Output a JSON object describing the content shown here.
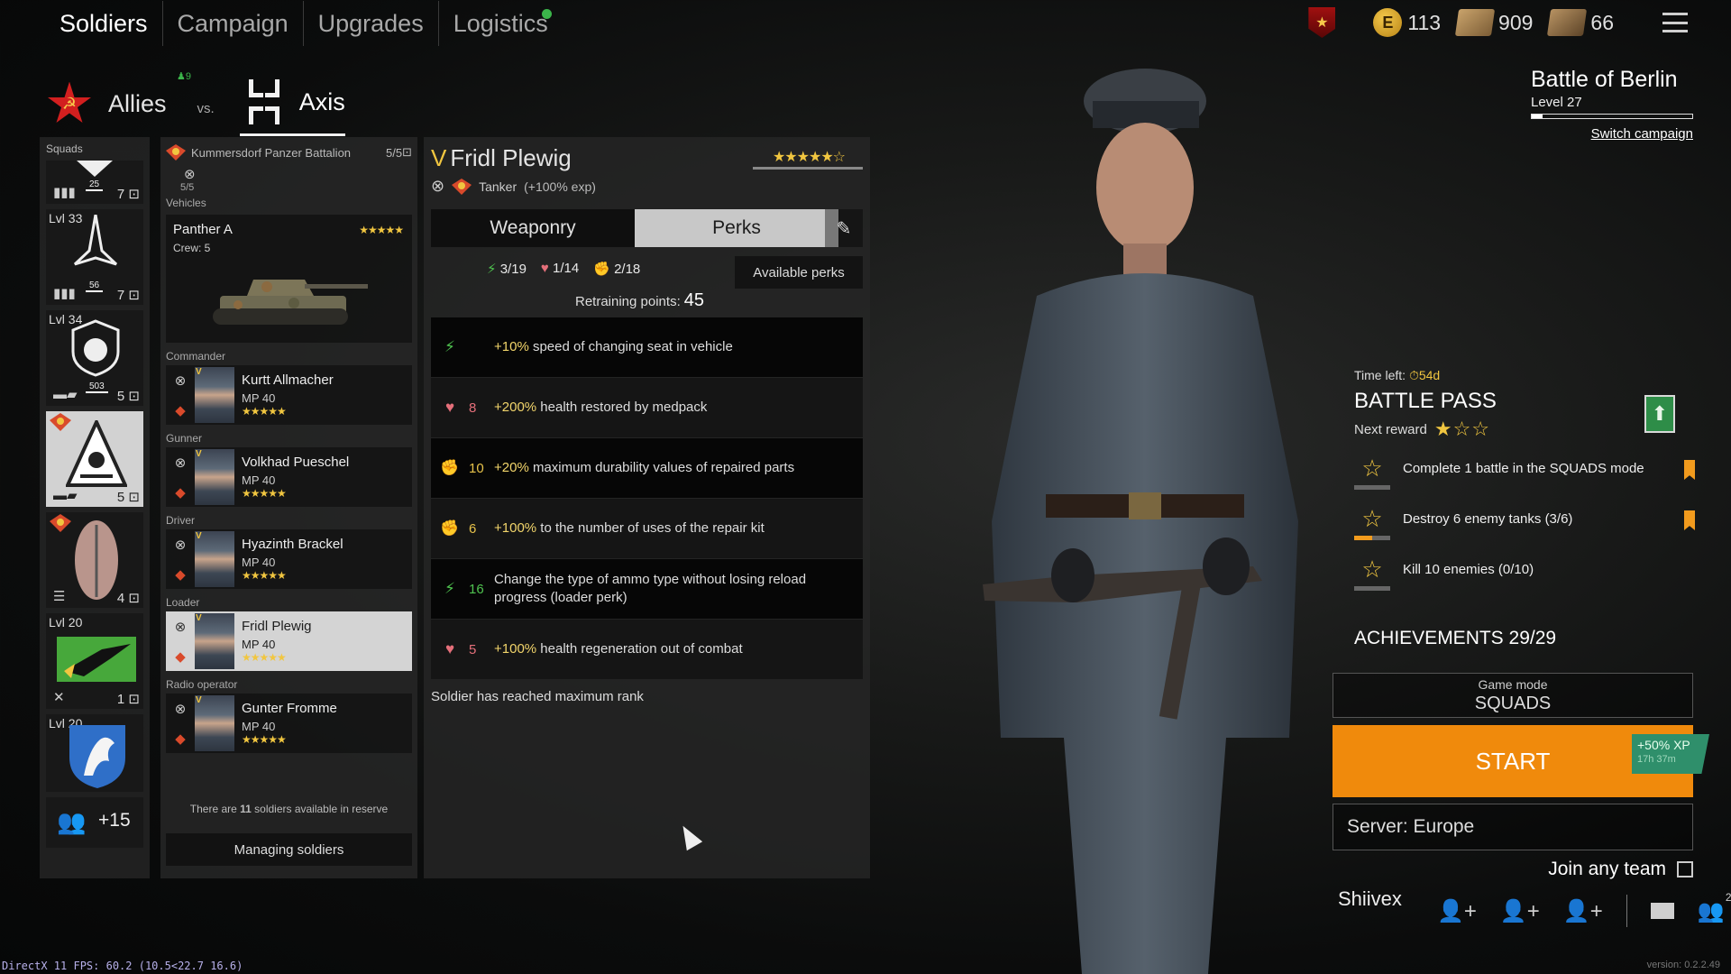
{
  "nav": {
    "tabs": [
      {
        "label": "Soldiers",
        "active": true
      },
      {
        "label": "Campaign"
      },
      {
        "label": "Upgrades"
      },
      {
        "label": "Logistics"
      }
    ]
  },
  "currencies": {
    "gold": "113",
    "tickets": "909",
    "orders": "66"
  },
  "faction": {
    "allies_label": "Allies",
    "allies_count": "♟9",
    "vs": "vs.",
    "axis_label": "Axis"
  },
  "squads": {
    "header": "Squads",
    "items": [
      {
        "level": "",
        "num": "25",
        "count": "7"
      },
      {
        "level": "Lvl 33",
        "num": "56",
        "count": "7"
      },
      {
        "level": "Lvl 34",
        "num": "503",
        "count": "5"
      },
      {
        "level": "",
        "num": "",
        "count": "5",
        "selected": true
      },
      {
        "level": "",
        "num": "",
        "count": "4"
      },
      {
        "level": "Lvl 20",
        "num": "",
        "count": "1"
      },
      {
        "level": "Lvl 20",
        "num": "",
        "count": ""
      }
    ],
    "reserve_more": "+15"
  },
  "squad": {
    "battalion": "Kummersdorf Panzer Battalion",
    "capacity": "5/5",
    "vehicle_slots": "5/5",
    "vehicles_label": "Vehicles",
    "vehicle": {
      "name": "Panther A",
      "crew": "Crew: 5",
      "stars": "★★★★★"
    },
    "members": [
      {
        "role": "Commander",
        "name": "Kurtt Allmacher",
        "weapon": "MP 40",
        "stars": "★★★★★"
      },
      {
        "role": "Gunner",
        "name": "Volkhad Pueschel",
        "weapon": "MP 40",
        "stars": "★★★★★"
      },
      {
        "role": "Driver",
        "name": "Hyazinth Brackel",
        "weapon": "MP 40",
        "stars": "★★★★★"
      },
      {
        "role": "Loader",
        "name": "Fridl Plewig",
        "weapon": "MP 40",
        "stars": "★★★★★",
        "selected": true
      },
      {
        "role": "Radio operator",
        "name": "Gunter Fromme",
        "weapon": "MP 40",
        "stars": "★★★★★"
      }
    ],
    "reserve_pre": "There are ",
    "reserve_num": "11",
    "reserve_post": " soldiers available in reserve",
    "manage_button": "Managing soldiers"
  },
  "detail": {
    "rank_v": "V",
    "name": "Fridl Plewig",
    "stars": "★★★★★☆",
    "class": "Tanker",
    "exp_bonus": "(+100% exp)",
    "tab_weaponry": "Weaponry",
    "tab_perks": "Perks",
    "counts": {
      "speed": "3/19",
      "health": "1/14",
      "repair": "2/18"
    },
    "available_perks": "Available perks",
    "retraining_label": "Retraining points:",
    "retraining_points": "45",
    "perks": [
      {
        "icon": "speed",
        "cost": "",
        "value": "+10%",
        "text": "speed of changing seat in vehicle"
      },
      {
        "icon": "health",
        "cost": "8",
        "value": "+200%",
        "text": "health restored by medpack"
      },
      {
        "icon": "repair",
        "cost": "10",
        "value": "+20%",
        "text": "maximum durability values of repaired parts"
      },
      {
        "icon": "repair",
        "cost": "6",
        "value": "+100%",
        "text": "to the number of uses of the repair kit"
      },
      {
        "icon": "speed",
        "cost": "16",
        "value": "",
        "text": "Change the type of ammo type without losing reload progress (loader perk)"
      },
      {
        "icon": "health",
        "cost": "5",
        "value": "+100%",
        "text": "health regeneration out of combat"
      }
    ],
    "max_rank": "Soldier has reached maximum rank"
  },
  "campaign": {
    "title": "Battle of Berlin",
    "level": "Level 27",
    "progress": 0.07,
    "switch": "Switch campaign"
  },
  "battle_pass": {
    "time_left_label": "Time left:",
    "time_left": "⏱54d",
    "title": "BATTLE PASS",
    "next_reward": "Next reward",
    "tasks": [
      {
        "text": "Complete 1 battle in the SQUADS mode",
        "progress": 0.0
      },
      {
        "text": "Destroy 6 enemy tanks (3/6)",
        "progress": 0.5
      },
      {
        "text": "Kill 10 enemies (0/10)",
        "progress": 0.0
      }
    ]
  },
  "achievements": "ACHIEVEMENTS 29/29",
  "game_mode": {
    "label": "Game mode",
    "value": "SQUADS"
  },
  "start": {
    "label": "START",
    "xp_bonus": "+50% XP",
    "xp_time": "17h 37m"
  },
  "server": "Server: Europe",
  "join_any_team": "Join any team",
  "player_name": "Shiivex",
  "friends_count": "2",
  "debug": "DirectX 11 FPS: 60.2 (10.5<22.7 16.6)",
  "version": "version: 0.2.2.49",
  "colors": {
    "accent": "#f08a0c",
    "gold": "#f1c640",
    "green": "#3bb54a"
  }
}
